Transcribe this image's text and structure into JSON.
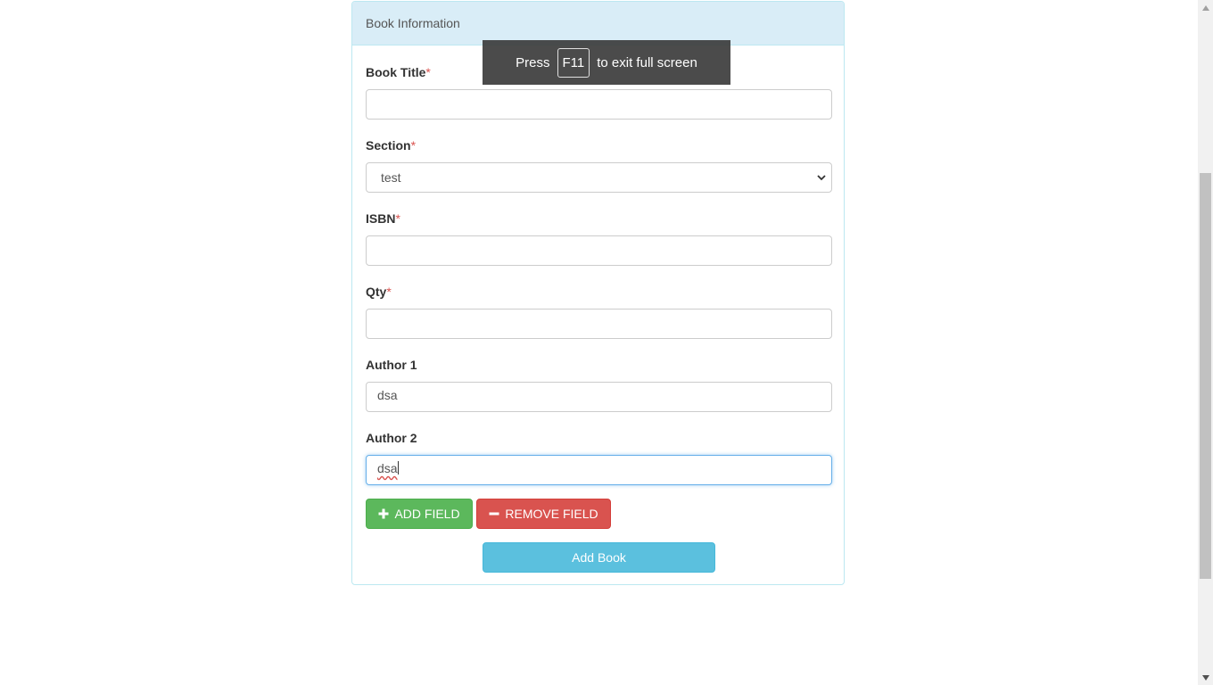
{
  "panel": {
    "heading": "Book Information"
  },
  "form": {
    "book_title": {
      "label": "Book Title",
      "required_mark": "*",
      "value": ""
    },
    "section": {
      "label": "Section",
      "required_mark": "*",
      "selected": "test"
    },
    "isbn": {
      "label": "ISBN",
      "required_mark": "*",
      "value": ""
    },
    "qty": {
      "label": "Qty",
      "required_mark": "*",
      "value": ""
    },
    "author1": {
      "label": "Author 1",
      "value": "dsa"
    },
    "author2": {
      "label": "Author 2",
      "value": "dsa"
    }
  },
  "buttons": {
    "add_field": "ADD FIELD",
    "remove_field": "REMOVE FIELD",
    "add_book": "Add Book"
  },
  "fullscreen_notice": {
    "before": "Press",
    "key": "F11",
    "after": "to exit full screen"
  },
  "icons": {
    "add_field": "plus-icon",
    "remove_field": "minus-icon",
    "select": "chevron-down-icon"
  },
  "colors": {
    "panel_heading_bg": "#d9edf7",
    "success": "#5cb85c",
    "danger": "#d9534f",
    "info": "#5bc0de",
    "required": "#d9534f"
  }
}
